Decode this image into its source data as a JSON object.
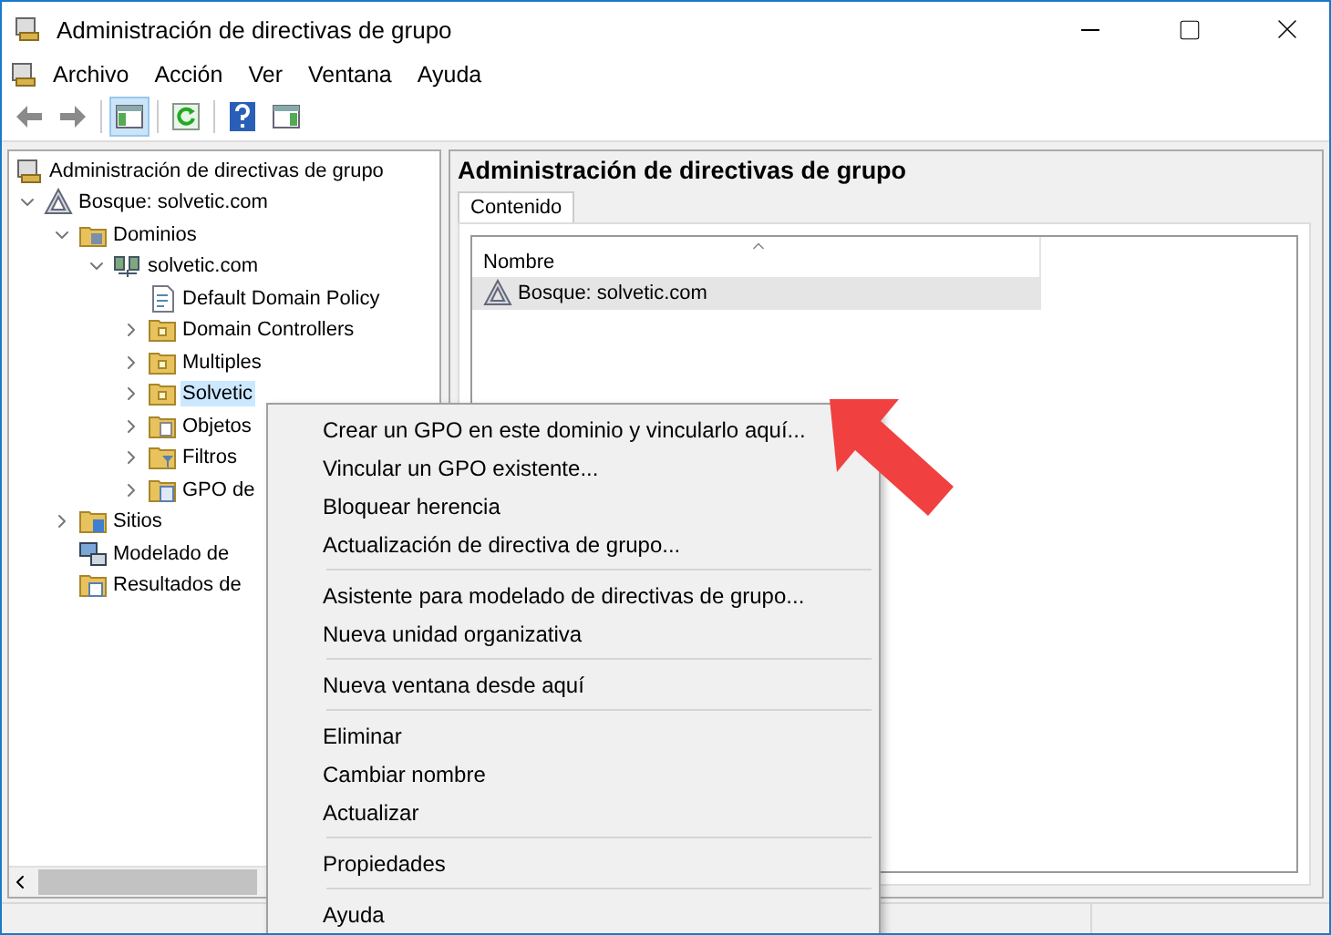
{
  "window": {
    "title": "Administración de directivas de grupo"
  },
  "menu": [
    "Archivo",
    "Acción",
    "Ver",
    "Ventana",
    "Ayuda"
  ],
  "toolbar": [
    {
      "kind": "back",
      "selected": false
    },
    {
      "kind": "forward",
      "selected": false
    },
    {
      "kind": "sep"
    },
    {
      "kind": "tree",
      "selected": true
    },
    {
      "kind": "sep"
    },
    {
      "kind": "refresh",
      "selected": false
    },
    {
      "kind": "sep"
    },
    {
      "kind": "help",
      "selected": false
    },
    {
      "kind": "pane",
      "selected": false
    }
  ],
  "tree": [
    {
      "label": "Administración de directivas de grupo",
      "kind": "root",
      "selected": false,
      "children": [
        {
          "label": "Bosque: solvetic.com",
          "kind": "forest",
          "expanded": true,
          "selected": false,
          "children": [
            {
              "label": "Dominios",
              "kind": "domains",
              "expanded": true,
              "selected": false,
              "children": [
                {
                  "label": "solvetic.com",
                  "kind": "domain",
                  "expanded": true,
                  "selected": false,
                  "children": [
                    {
                      "label": "Default Domain Policy",
                      "kind": "gpo",
                      "selected": false
                    },
                    {
                      "label": "Domain Controllers",
                      "kind": "ou",
                      "expanded": false,
                      "selected": false
                    },
                    {
                      "label": "Multiples",
                      "kind": "ou",
                      "expanded": false,
                      "selected": false
                    },
                    {
                      "label": "Solvetic",
                      "kind": "ou",
                      "expanded": false,
                      "selected": true
                    },
                    {
                      "label": "Objetos",
                      "kind": "container",
                      "expanded": false,
                      "selected": false
                    },
                    {
                      "label": "Filtros",
                      "kind": "filter",
                      "expanded": false,
                      "selected": false
                    },
                    {
                      "label": "GPO de",
                      "kind": "starter",
                      "expanded": false,
                      "selected": false
                    }
                  ]
                }
              ]
            },
            {
              "label": "Sitios",
              "kind": "sites",
              "expanded": false,
              "selected": false
            },
            {
              "label": "Modelado de",
              "kind": "modeling",
              "selected": false
            },
            {
              "label": "Resultados de",
              "kind": "results",
              "selected": false
            }
          ]
        }
      ]
    }
  ],
  "content": {
    "heading": "Administración de directivas de grupo",
    "tabs": [
      {
        "label": "Contenido",
        "selected": true
      }
    ],
    "columns": [
      "Nombre"
    ],
    "rows": [
      {
        "name": "Bosque: solvetic.com",
        "selected": true
      }
    ]
  },
  "context_menu": [
    {
      "kind": "item",
      "label": "Crear un GPO en este dominio y vincularlo aquí..."
    },
    {
      "kind": "item",
      "label": "Vincular un GPO existente..."
    },
    {
      "kind": "item",
      "label": "Bloquear herencia"
    },
    {
      "kind": "item",
      "label": "Actualización de directiva de grupo..."
    },
    {
      "kind": "separator"
    },
    {
      "kind": "item",
      "label": "Asistente para modelado de directivas de grupo..."
    },
    {
      "kind": "item",
      "label": "Nueva unidad organizativa"
    },
    {
      "kind": "separator"
    },
    {
      "kind": "item",
      "label": "Nueva ventana desde aquí"
    },
    {
      "kind": "separator"
    },
    {
      "kind": "item",
      "label": "Eliminar"
    },
    {
      "kind": "item",
      "label": "Cambiar nombre"
    },
    {
      "kind": "item",
      "label": "Actualizar"
    },
    {
      "kind": "separator"
    },
    {
      "kind": "item",
      "label": "Propiedades"
    },
    {
      "kind": "separator"
    },
    {
      "kind": "item",
      "label": "Ayuda"
    }
  ]
}
